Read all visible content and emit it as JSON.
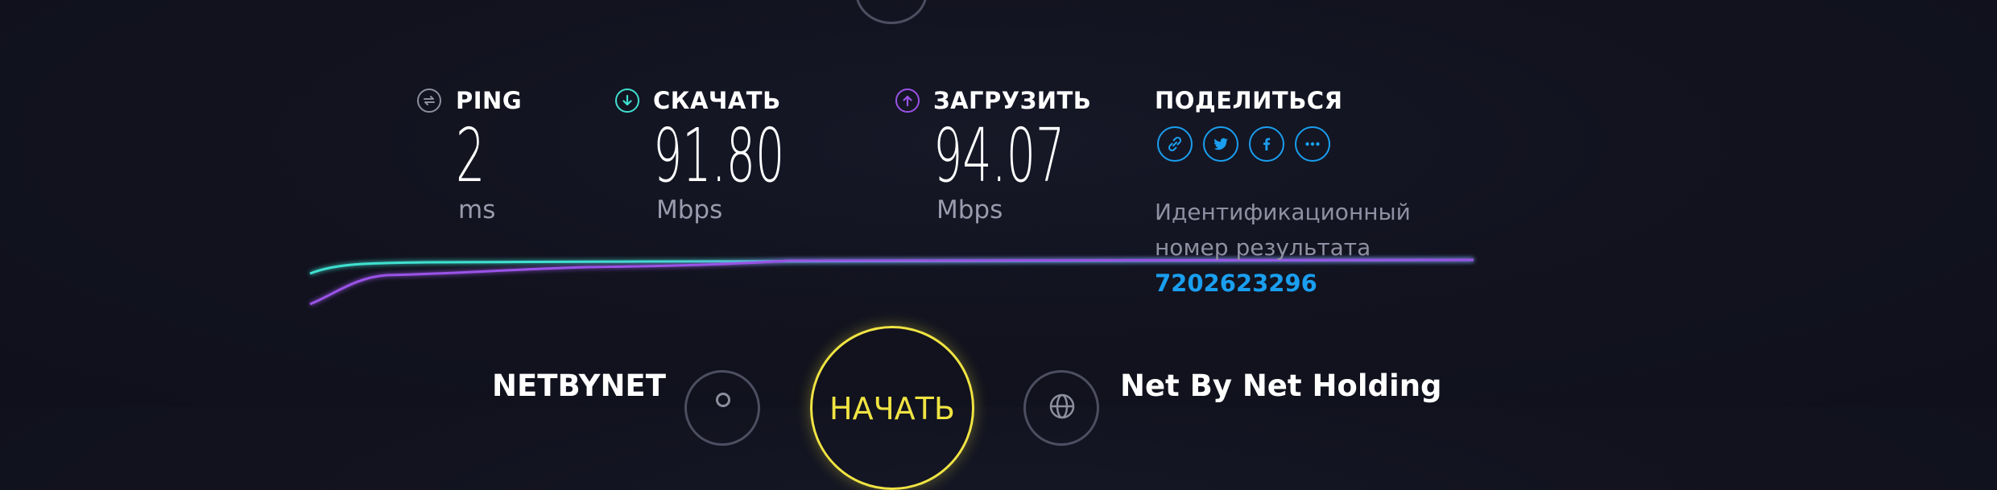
{
  "metrics": {
    "ping": {
      "label": "PING",
      "value": "2",
      "unit": "ms"
    },
    "download": {
      "label": "СКАЧАТЬ",
      "value": "91.80",
      "unit": "Mbps"
    },
    "upload": {
      "label": "ЗАГРУЗИТЬ",
      "value": "94.07",
      "unit": "Mbps"
    }
  },
  "share": {
    "label": "ПОДЕЛИТЬСЯ",
    "buttons": [
      "link-icon",
      "twitter-icon",
      "facebook-icon",
      "more-icon"
    ]
  },
  "result": {
    "label_line1": "Идентификационный",
    "label_line2": "номер результата",
    "id": "7202623296"
  },
  "isp": {
    "name": "NETBYNET"
  },
  "start_button": {
    "label": "НАЧАТЬ"
  },
  "server": {
    "name": "Net By Net Holding"
  },
  "colors": {
    "background": "#12131f",
    "download": "#3fe0d0",
    "upload": "#9a52e6",
    "accent": "#1a9ff0",
    "start": "#f0e443"
  }
}
